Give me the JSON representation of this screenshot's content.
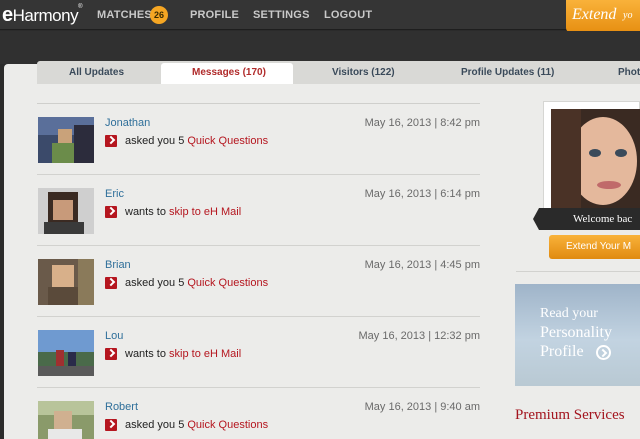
{
  "header": {
    "logo_prefix": "e",
    "logo_rest": "Harmony",
    "logo_mark": "®",
    "nav": {
      "matches": "MATCHES",
      "matches_count": "26",
      "profile": "PROFILE",
      "settings": "SETTINGS",
      "logout": "LOGOUT"
    },
    "extend_tab": "Extend",
    "extend_tab_tail": "yo"
  },
  "tabs": [
    {
      "label": "All Updates"
    },
    {
      "label": "Messages (170)"
    },
    {
      "label": "Visitors (122)"
    },
    {
      "label": "Profile Updates (11)"
    },
    {
      "label": "Phot"
    }
  ],
  "feed": [
    {
      "name": "Jonathan",
      "verb": "asked you 5 ",
      "link": "Quick Questions",
      "date": "May 16, 2013 | 8:42 pm"
    },
    {
      "name": "Eric",
      "verb": "wants to ",
      "link": "skip to eH Mail",
      "date": "May 16, 2013 | 6:14 pm"
    },
    {
      "name": "Brian",
      "verb": "asked you 5 ",
      "link": "Quick Questions",
      "date": "May 16, 2013 | 4:45 pm"
    },
    {
      "name": "Lou",
      "verb": "wants to ",
      "link": "skip to eH Mail",
      "date": "May 16, 2013 | 12:32 pm"
    },
    {
      "name": "Robert",
      "verb": "asked you 5 ",
      "link": "Quick Questions",
      "date": "May 16, 2013 | 9:40 am"
    }
  ],
  "sidebar": {
    "welcome": "Welcome bac",
    "extend_button": "Extend Your M",
    "promo": {
      "line1": "Read your",
      "line2": "Personality",
      "line3": "Profile"
    },
    "premium": "Premium Services"
  },
  "colors": {
    "accent_orange": "#f5a623",
    "link_red": "#b5161f",
    "name_blue": "#2f6f9a",
    "topbar": "#353535"
  },
  "icons": {
    "row_arrow": "chevron-right-icon",
    "promo_go": "circle-arrow-icon"
  }
}
